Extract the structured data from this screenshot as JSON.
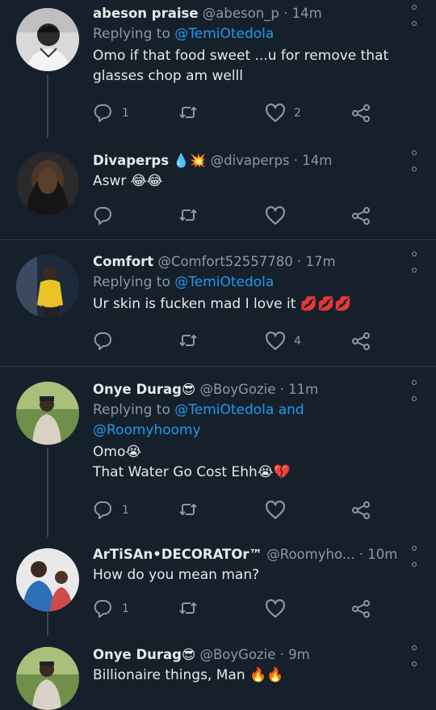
{
  "colors": {
    "background": "#15202b",
    "text": "#e7e9ea",
    "muted": "#8b98a5",
    "link": "#1d9bf0",
    "divider": "#2f3b47"
  },
  "tweets": [
    {
      "name": "abeson praise",
      "handle": "@abeson_p",
      "time": "· 14m",
      "replying_prefix": "Replying to",
      "replying_to": "@TemiOtedola",
      "text": "Omo if that food sweet ...u for remove that glasses chop am welll",
      "reply_count": "1",
      "retweet_count": "",
      "like_count": "2"
    },
    {
      "name": "Divaperps",
      "name_emoji": "💧💥",
      "handle": "@divaperps",
      "time": "· 14m",
      "text": "Aswr 😂😂",
      "reply_count": "",
      "retweet_count": "",
      "like_count": ""
    },
    {
      "name": "Comfort",
      "handle": "@Comfort52557780",
      "time": "· 17m",
      "replying_prefix": "Replying to",
      "replying_to": "@TemiOtedola",
      "text": "Ur skin is fucken mad I love it 💋💋💋",
      "reply_count": "",
      "retweet_count": "",
      "like_count": "4"
    },
    {
      "name": "Onye Durag",
      "name_emoji": "😎",
      "handle": "@BoyGozie",
      "time": "· 11m",
      "replying_prefix": "Replying to",
      "replying_to": "@TemiOtedola and",
      "replying_to_2": "@Roomyhoomy",
      "text_line1": "Omo😭",
      "text_line2": "That Water Go Cost Ehh😭💔",
      "reply_count": "1",
      "retweet_count": "",
      "like_count": ""
    },
    {
      "name": "ArTiSAn•DECORATOr™",
      "handle": "@Roomyho...",
      "time": "· 10m",
      "text": "How do you mean man?",
      "reply_count": "1",
      "retweet_count": "",
      "like_count": ""
    },
    {
      "name": "Onye Durag",
      "name_emoji": "😎",
      "handle": "@BoyGozie",
      "time": "· 9m",
      "text": "Billionaire things, Man 🔥🔥"
    }
  ]
}
